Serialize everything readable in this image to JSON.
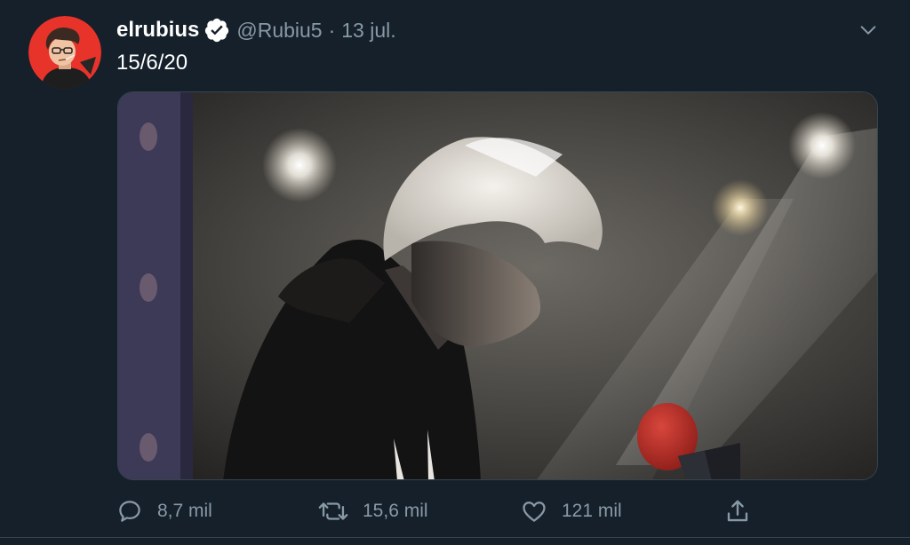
{
  "tweet": {
    "display_name": "elrubius",
    "handle": "@Rubiu5",
    "separator": "·",
    "date": "13 jul.",
    "text": "15/6/20",
    "verified": true
  },
  "icons": {
    "avatar": "avatar-icon",
    "verified": "verified-badge-icon",
    "caret": "chevron-down-icon",
    "reply": "reply-icon",
    "retweet": "retweet-icon",
    "like": "heart-icon",
    "share": "share-icon"
  },
  "actions": {
    "reply_count": "8,7 mil",
    "retweet_count": "15,6 mil",
    "like_count": "121 mil"
  },
  "colors": {
    "background": "#15202b",
    "secondary_text": "#8899a6",
    "verified": "#ffffff",
    "avatar_bg": "#e8332a"
  }
}
